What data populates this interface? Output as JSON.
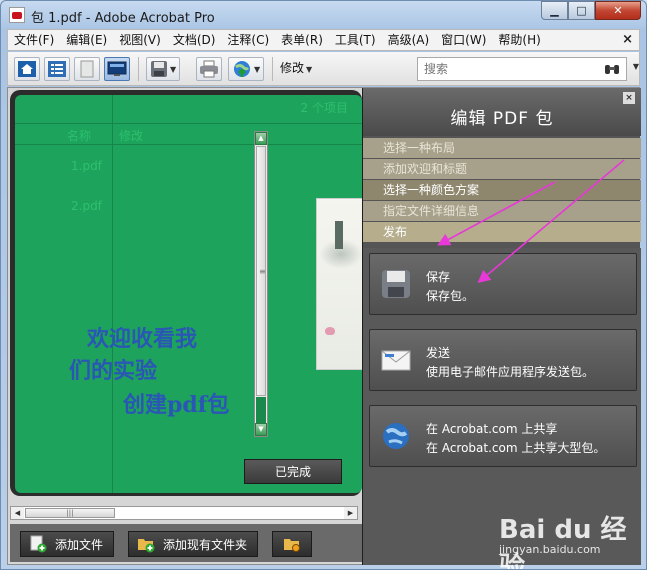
{
  "window": {
    "title": "包 1.pdf - Adobe Acrobat Pro",
    "minimize": "▁",
    "maximize": "□",
    "close": "✕"
  },
  "menu": {
    "items": [
      "文件(F)",
      "编辑(E)",
      "视图(V)",
      "文档(D)",
      "注释(C)",
      "表单(R)",
      "工具(T)",
      "高级(A)",
      "窗口(W)",
      "帮助(H)"
    ],
    "close": "×"
  },
  "toolbar": {
    "modify_label": "修改",
    "search_placeholder": "搜索"
  },
  "package": {
    "welcome_line1": "欢迎收看我",
    "welcome_line2": "们的实验",
    "welcome_line3": "创建pdf包",
    "faint_count": "2 个项目",
    "faint_col1": "名称",
    "faint_col2": "修改",
    "faint_row1": "1.pdf",
    "faint_row2": "2.pdf",
    "done_button": "已完成",
    "scroll_grip": "≡",
    "hscroll_grip": "|||"
  },
  "bottom_bar": {
    "add_file": "添加文件",
    "add_folder": "添加现有文件夹"
  },
  "edit_panel": {
    "title": "编辑 PDF 包",
    "close": "×",
    "steps": [
      "选择一种布局",
      "添加欢迎和标题",
      "选择一种颜色方案",
      "指定文件详细信息",
      "发布"
    ],
    "actions": [
      {
        "title": "保存",
        "desc": "保存包。"
      },
      {
        "title": "发送",
        "desc": "使用电子邮件应用程序发送包。"
      },
      {
        "title": "在 Acrobat.com 上共享",
        "desc": "在 Acrobat.com 上共享大型包。"
      }
    ]
  },
  "watermark": {
    "brand": "Bai du 经验",
    "url": "jingyan.baidu.com"
  },
  "colors": {
    "accent_green": "#1ea35c",
    "arrow_magenta": "#e838d8",
    "welcome_blue": "#2a57b5"
  }
}
